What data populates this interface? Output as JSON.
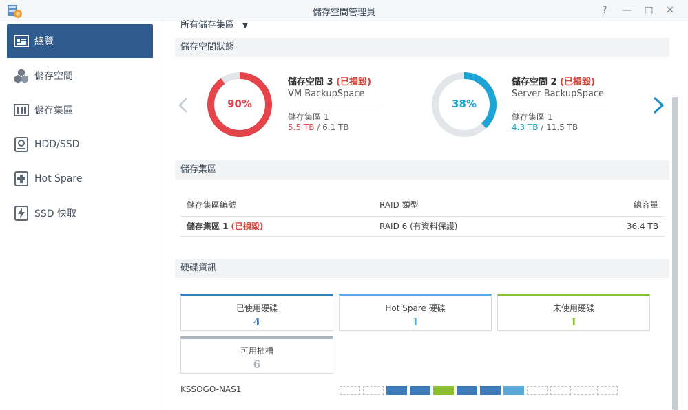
{
  "window": {
    "title": "儲存空間管理員",
    "controls": {
      "help": "?",
      "minimize": "—",
      "maximize": "□",
      "close": "✕"
    }
  },
  "sidebar": {
    "items": [
      {
        "label": "總覽",
        "icon": "overview-icon",
        "active": true
      },
      {
        "label": "儲存空間",
        "icon": "volume-cubes-icon",
        "active": false
      },
      {
        "label": "儲存集區",
        "icon": "storage-pool-icon",
        "active": false
      },
      {
        "label": "HDD/SSD",
        "icon": "hdd-icon",
        "active": false
      },
      {
        "label": "Hot Spare",
        "icon": "hot-spare-icon",
        "active": false
      },
      {
        "label": "SSD 快取",
        "icon": "ssd-cache-icon",
        "active": false
      }
    ]
  },
  "main": {
    "filter": {
      "label": "所有儲存集區"
    },
    "status_section": {
      "title": "儲存空間狀態",
      "volumes": [
        {
          "name": "儲存空間 3",
          "state": "(已損毀)",
          "description": "VM BackupSpace",
          "pool": "儲存集區 1",
          "used": "5.5 TB",
          "separator": " / ",
          "total": "6.1 TB",
          "percent": 90,
          "percent_label": "90%",
          "color": "#e5444a"
        },
        {
          "name": "儲存空間 2",
          "state": "(已損毀)",
          "description": "Server BackupSpace",
          "pool": "儲存集區 1",
          "used": "4.3 TB",
          "separator": " / ",
          "total": "11.5 TB",
          "percent": 38,
          "percent_label": "38%",
          "color": "#1da3d4"
        }
      ]
    },
    "pool_section": {
      "title": "儲存集區",
      "columns": [
        "儲存集區編號",
        "RAID 類型",
        "總容量"
      ],
      "rows": [
        {
          "name": "儲存集區 1",
          "state": "(已損毀)",
          "raid": "RAID 6 (有資料保護)",
          "capacity": "36.4 TB"
        }
      ]
    },
    "disk_section": {
      "title": "硬碟資訊",
      "cards": [
        {
          "label": "已使用硬碟",
          "value": "4",
          "color": "#3d7bbd"
        },
        {
          "label": "Hot Spare 硬碟",
          "value": "1",
          "color": "#59a9d9"
        },
        {
          "label": "未使用硬碟",
          "value": "1",
          "color": "#8cbf2e"
        },
        {
          "label": "可用插槽",
          "value": "6",
          "color": "#a8b4be"
        }
      ],
      "nas_name": "KSSOGO-NAS1",
      "slots": [
        "empty",
        "empty",
        "used",
        "used",
        "unused",
        "used",
        "used",
        "hotspare",
        "empty",
        "empty",
        "empty",
        "empty"
      ],
      "slot_colors": {
        "used": "#3d7bbd",
        "unused": "#8cbf2e",
        "hotspare": "#59a9d9"
      }
    }
  }
}
